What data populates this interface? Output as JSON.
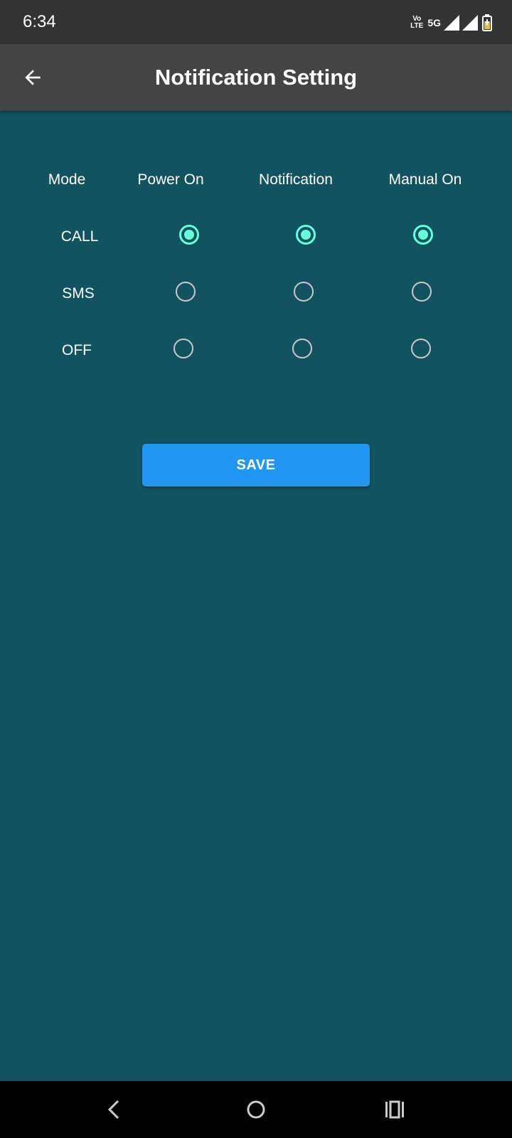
{
  "status_bar": {
    "time": "6:34",
    "volte_top": "Vo",
    "volte_bottom": "LTE",
    "network": "5G"
  },
  "app_bar": {
    "title": "Notification Setting",
    "back_icon": "arrow-back-icon"
  },
  "grid": {
    "columns": [
      "Mode",
      "Power On",
      "Notification",
      "Manual On"
    ],
    "rows": [
      {
        "label": "CALL",
        "selected": [
          true,
          true,
          true
        ]
      },
      {
        "label": "SMS",
        "selected": [
          false,
          false,
          false
        ]
      },
      {
        "label": "OFF",
        "selected": [
          false,
          false,
          false
        ]
      }
    ]
  },
  "save_label": "SAVE",
  "colors": {
    "background": "#125361",
    "app_bar": "#444444",
    "status_bar": "#333333",
    "radio_checked": "#64ffda",
    "radio_unchecked": "#c9c9c9",
    "button": "#2196f3"
  },
  "nav_bar": {
    "icons": [
      "nav-back-icon",
      "nav-home-icon",
      "nav-recents-icon"
    ]
  }
}
